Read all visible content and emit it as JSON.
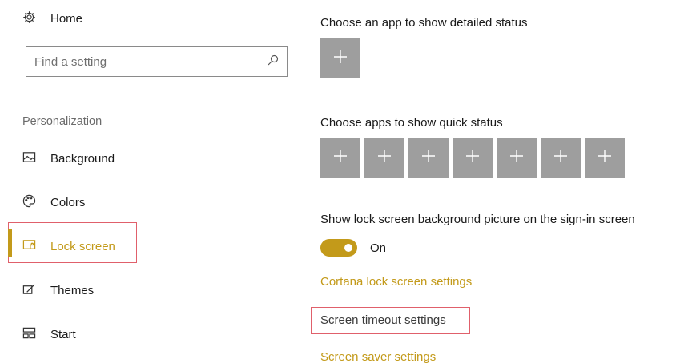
{
  "nav": {
    "home_label": "Home",
    "search_placeholder": "Find a setting",
    "section_title": "Personalization",
    "items": [
      {
        "label": "Background",
        "icon": "image-icon"
      },
      {
        "label": "Colors",
        "icon": "palette-icon"
      },
      {
        "label": "Lock screen",
        "icon": "lock-screen-icon",
        "selected": true
      },
      {
        "label": "Themes",
        "icon": "themes-icon"
      },
      {
        "label": "Start",
        "icon": "start-icon"
      }
    ]
  },
  "content": {
    "detailed_status_label": "Choose an app to show detailed status",
    "quick_status_label": "Choose apps to show quick status",
    "quick_status_slot_count": 7,
    "signin_bg_label": "Show lock screen background picture on the sign-in screen",
    "toggle": {
      "state": "On",
      "checked": true
    },
    "links": {
      "cortana": "Cortana lock screen settings",
      "timeout": "Screen timeout settings",
      "saver": "Screen saver settings"
    }
  },
  "colors": {
    "accent": "#c39a1a",
    "tile": "#9e9e9e",
    "highlight_box": "#e0606b"
  }
}
